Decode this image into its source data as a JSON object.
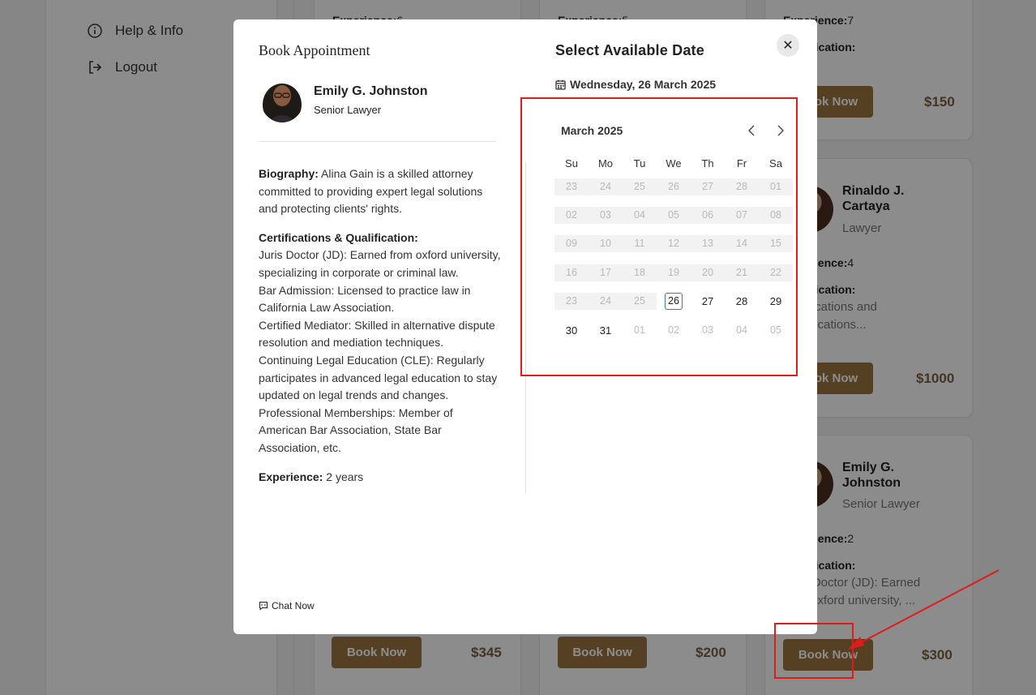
{
  "sidebar": {
    "items": [
      {
        "label": "Help & Info",
        "icon": "info-icon"
      },
      {
        "label": "Logout",
        "icon": "logout-icon"
      }
    ]
  },
  "cards": {
    "row1": [
      {
        "exp_label": "Experience:",
        "exp_value": "6"
      },
      {
        "exp_label": "Experience:",
        "exp_value": "5"
      },
      {
        "exp_label": "Experience:",
        "exp_value": "7",
        "qual_label": "Qualification:",
        "book_label": "Book Now",
        "price": "$150"
      }
    ],
    "rinaldo": {
      "name": "Rinaldo J. Cartaya",
      "role": "Lawyer",
      "exp_label": "Experience:",
      "exp_value": "4",
      "qual_label": "Qualification:",
      "qual_text_1": "Certifications and",
      "qual_text_2": "Qualifications...",
      "book_label": "Book Now",
      "price": "$1000"
    },
    "emily": {
      "name": "Emily G. Johnston",
      "role": "Senior Lawyer",
      "exp_label": "Experience:",
      "exp_value": "2",
      "qual_label": "Qualification:",
      "qual_text_1": "Juris Doctor (JD): Earned",
      "qual_text_2": "from oxford university, ...",
      "book_label": "Book Now",
      "price": "$300"
    },
    "row3": [
      {
        "book_label": "Book Now",
        "price": "$345"
      },
      {
        "book_label": "Book Now",
        "price": "$200"
      }
    ]
  },
  "modal": {
    "title": "Book Appointment",
    "lawyer_name": "Emily G. Johnston",
    "lawyer_role": "Senior Lawyer",
    "bio_label": "Biography:",
    "bio_text": "Alina Gain is a skilled attorney committed to providing expert legal solutions and protecting clients' rights.",
    "cert_label": "Certifications & Qualification:",
    "cert_lines": [
      "Juris Doctor (JD): Earned from oxford university, specializing in  corporate or criminal law.",
      "Bar Admission: Licensed to practice law in California Law Association.",
      "Certified Mediator: Skilled in alternative dispute resolution and mediation techniques.",
      "Continuing Legal Education (CLE): Regularly participates in advanced legal education to stay updated on legal trends and changes.",
      "Professional Memberships: Member of American Bar Association, State Bar Association, etc."
    ],
    "exp_label": "Experience:",
    "exp_value": "2 years",
    "chat_label": "Chat Now",
    "select_title": "Select Available Date",
    "selected_date": "Wednesday, 26 March 2025",
    "close_label": "✕"
  },
  "calendar": {
    "month_label": "March 2025",
    "weekdays": [
      "Su",
      "Mo",
      "Tu",
      "We",
      "Th",
      "Fr",
      "Sa"
    ],
    "weeks": [
      [
        {
          "d": "23",
          "s": "disabled"
        },
        {
          "d": "24",
          "s": "disabled"
        },
        {
          "d": "25",
          "s": "disabled"
        },
        {
          "d": "26",
          "s": "disabled"
        },
        {
          "d": "27",
          "s": "disabled"
        },
        {
          "d": "28",
          "s": "disabled"
        },
        {
          "d": "01",
          "s": "disabled"
        }
      ],
      [
        {
          "d": "02",
          "s": "disabled"
        },
        {
          "d": "03",
          "s": "disabled"
        },
        {
          "d": "04",
          "s": "disabled"
        },
        {
          "d": "05",
          "s": "disabled"
        },
        {
          "d": "06",
          "s": "disabled"
        },
        {
          "d": "07",
          "s": "disabled"
        },
        {
          "d": "08",
          "s": "disabled"
        }
      ],
      [
        {
          "d": "09",
          "s": "disabled"
        },
        {
          "d": "10",
          "s": "disabled"
        },
        {
          "d": "11",
          "s": "disabled"
        },
        {
          "d": "12",
          "s": "disabled"
        },
        {
          "d": "13",
          "s": "disabled"
        },
        {
          "d": "14",
          "s": "disabled"
        },
        {
          "d": "15",
          "s": "disabled"
        }
      ],
      [
        {
          "d": "16",
          "s": "disabled"
        },
        {
          "d": "17",
          "s": "disabled"
        },
        {
          "d": "18",
          "s": "disabled"
        },
        {
          "d": "19",
          "s": "disabled"
        },
        {
          "d": "20",
          "s": "disabled"
        },
        {
          "d": "21",
          "s": "disabled"
        },
        {
          "d": "22",
          "s": "disabled"
        }
      ],
      [
        {
          "d": "23",
          "s": "disabled"
        },
        {
          "d": "24",
          "s": "disabled"
        },
        {
          "d": "25",
          "s": "disabled"
        },
        {
          "d": "26",
          "s": "today"
        },
        {
          "d": "27",
          "s": "active"
        },
        {
          "d": "28",
          "s": "active"
        },
        {
          "d": "29",
          "s": "active"
        }
      ],
      [
        {
          "d": "30",
          "s": "active"
        },
        {
          "d": "31",
          "s": "active"
        },
        {
          "d": "01",
          "s": "other"
        },
        {
          "d": "02",
          "s": "other"
        },
        {
          "d": "03",
          "s": "other"
        },
        {
          "d": "04",
          "s": "other"
        },
        {
          "d": "05",
          "s": "other"
        }
      ]
    ]
  },
  "colors": {
    "accent": "#9c7540",
    "annotation": "#e01b1b",
    "today_border": "#3a78c2"
  }
}
